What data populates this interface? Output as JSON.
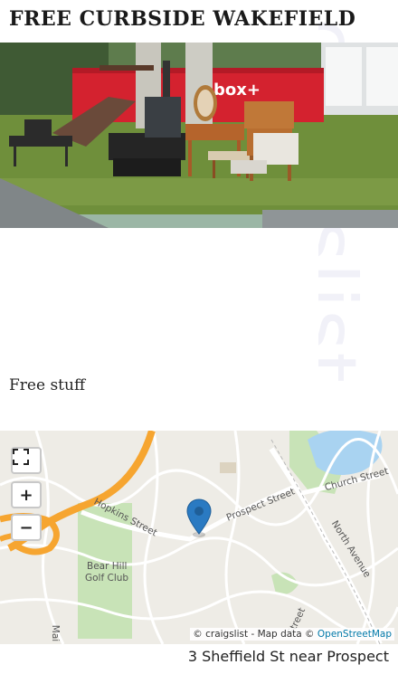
{
  "watermark": "craigslist",
  "posting": {
    "title": "FREE CURBSIDE WAKEFIELD",
    "photo_alt": "Furniture and items at curbside in front of a dumpster",
    "dumpster_brand": "box+",
    "description": "Free stuff",
    "address": "3 Sheffield St near Prospect"
  },
  "map": {
    "streets": {
      "hopkins": "Hopkins Street",
      "prospect": "Prospect Street",
      "church": "Church Street",
      "north_avenue": "North Avenue",
      "main": "Mai",
      "street_fragment": "Street"
    },
    "places": {
      "golf_club_line1": "Bear Hill",
      "golf_club_line2": "Golf Club"
    },
    "controls": {
      "fullscreen_icon": "fullscreen-icon",
      "zoom_in": "+",
      "zoom_out": "−"
    },
    "attribution": {
      "prefix": "© craigslist - Map data © ",
      "link": "OpenStreetMap"
    },
    "colors": {
      "land": "#eeece6",
      "park": "#c8e3b7",
      "water": "#a9d3f1",
      "highway": "#f6a530",
      "road": "#ffffff",
      "marker": "#2a7ac2"
    }
  }
}
